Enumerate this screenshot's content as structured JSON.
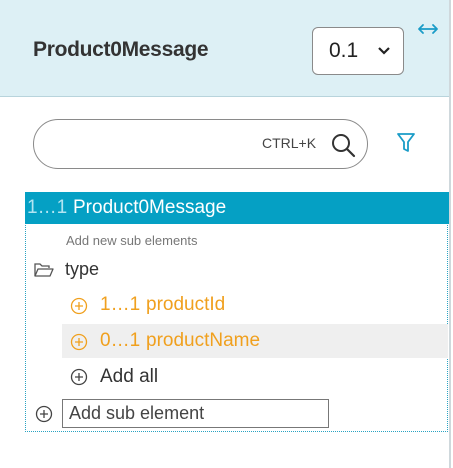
{
  "header": {
    "title": "Product0Message",
    "version": "0.1",
    "resize_icon": "horizontal-resize-icon"
  },
  "search": {
    "placeholder": "",
    "shortcut": "CTRL+K",
    "icon": "search-icon",
    "filter_icon": "filter-icon"
  },
  "tree": {
    "root": {
      "cardinality": "1…1",
      "name": "Product0Message"
    },
    "hint": "Add new sub elements",
    "group": {
      "label": "type",
      "icon": "folder-open-icon"
    },
    "children": [
      {
        "cardinality": "1…1",
        "name": "productId"
      },
      {
        "cardinality": "0…1",
        "name": "productName"
      }
    ],
    "add_all_label": "Add all",
    "add_sub_placeholder": "Add sub element"
  },
  "colors": {
    "header_bg": "#ddf0f5",
    "accent": "#05a0c4",
    "optional_child": "#f0a01e"
  }
}
